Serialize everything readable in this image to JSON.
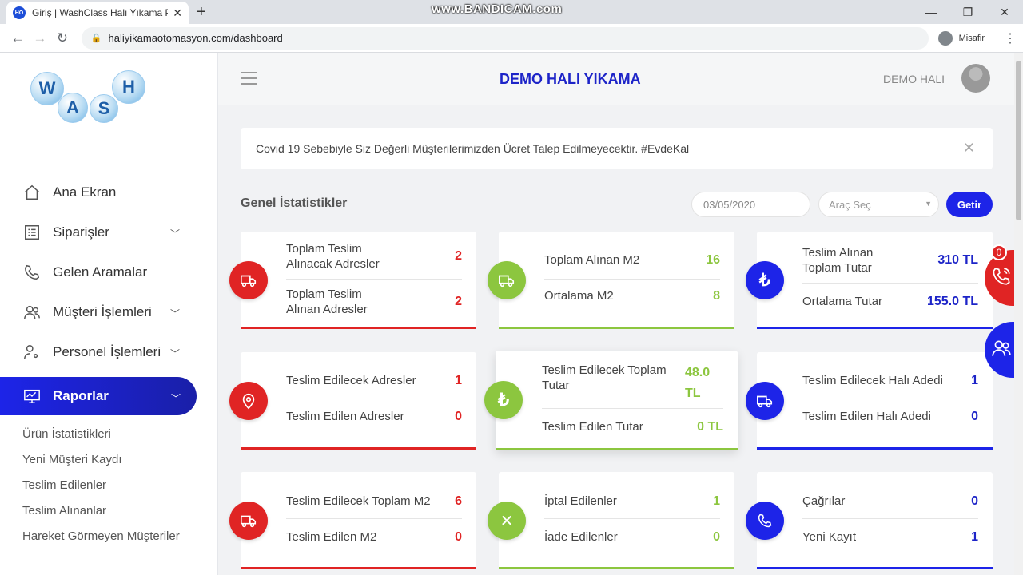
{
  "browser": {
    "tab_title": "Giriş | WashClass Halı Yıkama Pro",
    "favicon": "HO",
    "url": "haliyikamaotomasyon.com/dashboard",
    "profile": "Misafir",
    "watermark": "www.BANDICAM.com"
  },
  "logo": {
    "letters": [
      "W",
      "A",
      "S",
      "H"
    ]
  },
  "sidebar": {
    "items": [
      {
        "label": "Ana Ekran",
        "icon": "home-icon"
      },
      {
        "label": "Siparişler",
        "icon": "list-icon"
      },
      {
        "label": "Gelen Aramalar",
        "icon": "phone-icon"
      },
      {
        "label": "Müşteri İşlemleri",
        "icon": "users-icon"
      },
      {
        "label": "Personel İşlemleri",
        "icon": "user-gear-icon"
      },
      {
        "label": "Raporlar",
        "icon": "monitor-chart-icon"
      }
    ],
    "subitems": [
      "Ürün İstatistikleri",
      "Yeni Müşteri Kaydı",
      "Teslim Edilenler",
      "Teslim Alınanlar",
      "Hareket Görmeyen Müşteriler"
    ]
  },
  "header": {
    "brand": "DEMO HALI YIKAMA",
    "user": "DEMO HALI"
  },
  "alert": {
    "text": "Covid 19 Sebebiyle Siz Değerli Müşterilerimizden Ücret Talep Edilmeyecektir. #EvdeKal"
  },
  "stats": {
    "title": "Genel İstatistikler",
    "date": "03/05/2020",
    "vehicle_placeholder": "Araç Seç",
    "button": "Getir"
  },
  "cards": [
    {
      "r1": "Toplam Teslim Alınacak Adresler",
      "v1": "2",
      "r2": "Toplam Teslim Alınan Adresler",
      "v2": "2"
    },
    {
      "r1": "Toplam Alınan M2",
      "v1": "16",
      "r2": "Ortalama M2",
      "v2": "8"
    },
    {
      "r1": "Teslim Alınan Toplam Tutar",
      "v1": "310 TL",
      "r2": "Ortalama Tutar",
      "v2": "155.0 TL"
    },
    {
      "r1": "Teslim Edilecek Adresler",
      "v1": "1",
      "r2": "Teslim Edilen Adresler",
      "v2": "0"
    },
    {
      "r1": "Teslim Edilecek Toplam Tutar",
      "v1": "48.0 TL",
      "r2": "Teslim Edilen Tutar",
      "v2": "0 TL"
    },
    {
      "r1": "Teslim Edilecek Halı Adedi",
      "v1": "1",
      "r2": "Teslim Edilen Halı Adedi",
      "v2": "0"
    },
    {
      "r1": "Teslim Edilecek Toplam M2",
      "v1": "6",
      "r2": "Teslim Edilen M2",
      "v2": "0"
    },
    {
      "r1": "İptal Edilenler",
      "v1": "1",
      "r2": "İade Edilenler",
      "v2": "0"
    },
    {
      "r1": "Çağrılar",
      "v1": "0",
      "r2": "Yeni Kayıt",
      "v2": "1"
    }
  ],
  "float_badge": "0",
  "colors": {
    "red": "#e02424",
    "green": "#8cc63f",
    "blue": "#1d24e8"
  }
}
